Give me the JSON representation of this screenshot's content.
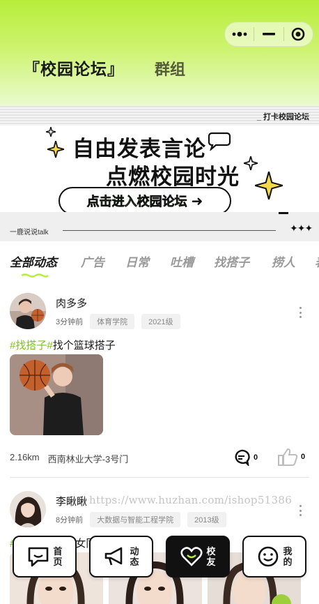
{
  "header": {
    "tab_forum": "『校园论坛』",
    "tab_group": "群组",
    "capsule": {
      "more_icon": "more-dots-icon",
      "minimize_icon": "minimize-icon",
      "close_icon": "target-icon"
    }
  },
  "stripe": {
    "text": "_ 打卡校园论坛"
  },
  "banner": {
    "line1": "自由发表言论",
    "line2": "点燃校园时光",
    "cta": "点击进入校园论坛",
    "arrow": "➜"
  },
  "talkbar": {
    "text": "一鹿说说talk",
    "stars": "✦✦✦"
  },
  "tabs": [
    "全部动态",
    "广告",
    "日常",
    "吐槽",
    "找搭子",
    "捞人",
    "表"
  ],
  "colors": {
    "accent": "#b7ee3a",
    "hashtag": "#7cc11c"
  },
  "posts": [
    {
      "name": "肉多多",
      "time": "3分钟前",
      "college": "体育学院",
      "grade": "2021级",
      "hashtag": "#找搭子#",
      "content": "找个篮球搭子",
      "distance": "2.16km",
      "location": "西南林业大学-3号门",
      "comments": "0",
      "likes": "0"
    },
    {
      "name": "李瞅瞅",
      "time": "8分钟前",
      "college": "大数据与智能工程学院",
      "grade": "2013级",
      "hashtag": "#",
      "content": "女同"
    }
  ],
  "watermark": "https://www.huzhan.com/ishop51386",
  "nav": {
    "home": "首页",
    "home_label": [
      "首",
      "页"
    ],
    "feed_label": [
      "动",
      "态"
    ],
    "friends_label": [
      "校",
      "友"
    ],
    "mine_label": [
      "我",
      "的"
    ]
  }
}
